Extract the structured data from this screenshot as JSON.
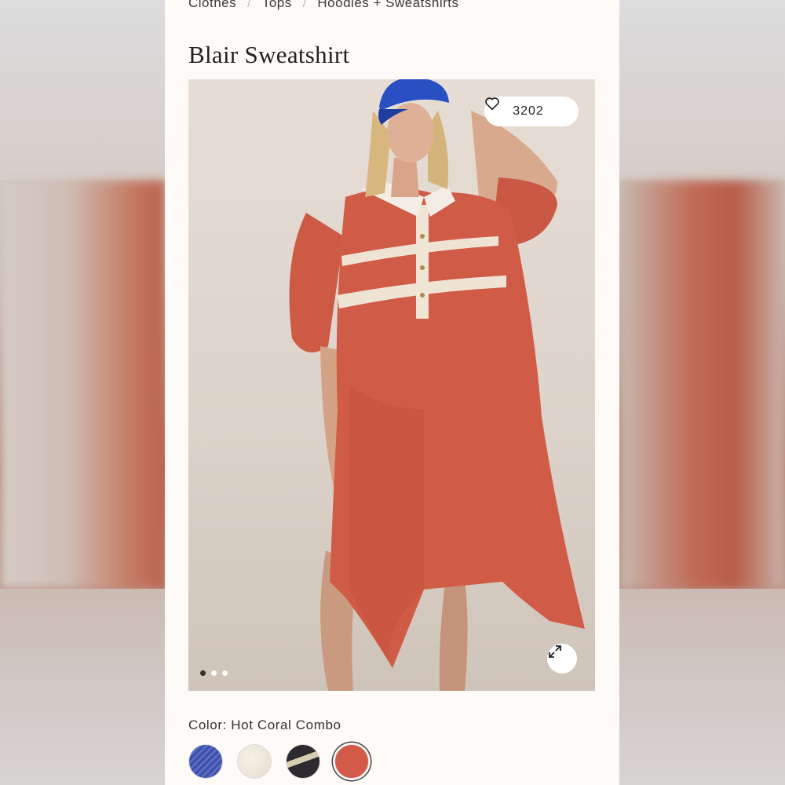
{
  "breadcrumb": [
    "Clothes",
    "Tops",
    "Hoodies + Sweatshirts"
  ],
  "product": {
    "title": "Blair Sweatshirt",
    "likes": "3202",
    "color_label": "Color: Hot Coral Combo"
  },
  "carousel": {
    "count": 3,
    "active_index": 0
  },
  "icons": {
    "like": "heart-icon",
    "expand": "expand-arrows-icon"
  },
  "swatches": [
    {
      "name": "blue",
      "color": "#3c4fa8"
    },
    {
      "name": "cream",
      "color": "#ece6d8"
    },
    {
      "name": "black stripe",
      "color": "#2e2b30"
    },
    {
      "name": "hot coral",
      "color": "#d35a48",
      "selected": true
    }
  ],
  "colors": {
    "accent_coral": "#d35a48",
    "panel_bg": "#fdfaf8"
  }
}
